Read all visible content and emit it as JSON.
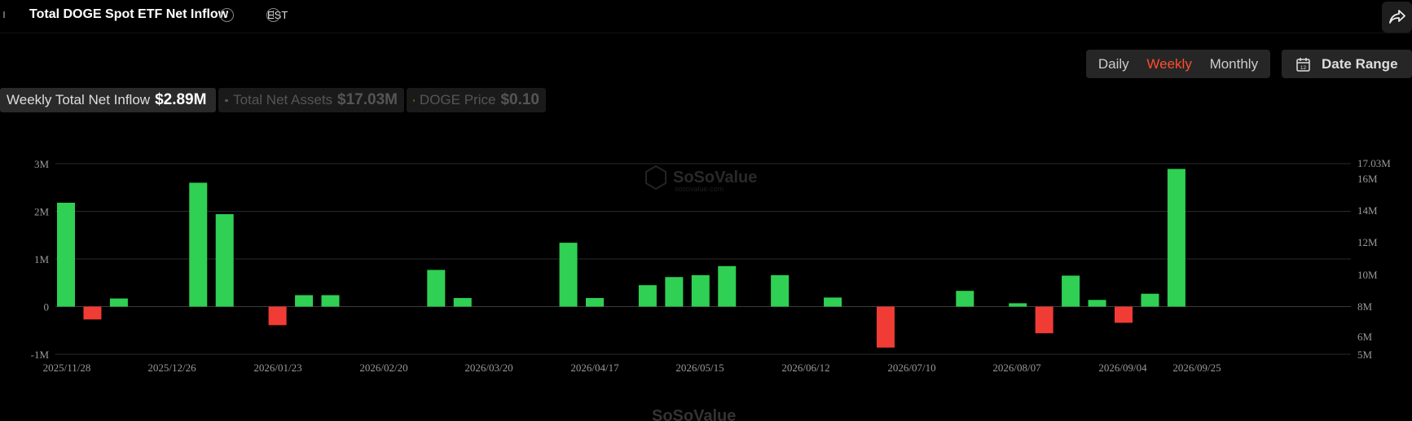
{
  "header": {
    "title": "Total DOGE Spot ETF Net Inflow",
    "timezone": "EST"
  },
  "controls": {
    "periods": [
      "Daily",
      "Weekly",
      "Monthly"
    ],
    "active_period": "Weekly",
    "date_range_label": "Date Range"
  },
  "metrics": [
    {
      "label": "Weekly Total Net Inflow",
      "value": "$2.89M",
      "state": "active"
    },
    {
      "label": "Total Net Assets",
      "value": "$17.03M",
      "state": "inactive",
      "color": "#555555"
    },
    {
      "label": "DOGE Price",
      "value": "$0.10",
      "state": "inactive",
      "color": "#6b5200"
    }
  ],
  "watermark": {
    "brand": "SoSoValue",
    "sub": "sosovalue.com"
  },
  "colors": {
    "positive": "#2fd053",
    "negative": "#f03c35",
    "grid": "#2a2a2a",
    "axis_text": "#999999"
  },
  "chart_data": {
    "type": "bar",
    "title": "Total DOGE Spot ETF Net Inflow",
    "left_axis": {
      "ticks": [
        "-1M",
        "0",
        "1M",
        "2M",
        "3M"
      ],
      "range": [
        -1000000,
        3000000
      ]
    },
    "right_axis": {
      "ticks": [
        "5M",
        "6M",
        "8M",
        "10M",
        "12M",
        "14M",
        "16M",
        "17.03M"
      ]
    },
    "x_tick_labels": [
      "2025/11/28",
      "2025/12/26",
      "2026/01/23",
      "2026/02/20",
      "2026/03/20",
      "2026/04/17",
      "2026/05/15",
      "2026/06/12",
      "2026/07/10",
      "2026/08/07",
      "2026/09/04",
      "2026/09/25"
    ],
    "series": [
      {
        "values": [
          2180000,
          -270000,
          170000,
          0,
          0,
          2600000,
          1940000,
          0,
          -390000,
          240000,
          240000,
          0,
          0,
          0,
          770000,
          180000,
          0,
          0,
          0,
          1340000,
          180000,
          0,
          450000,
          620000,
          660000,
          850000,
          0,
          660000,
          0,
          190000,
          0,
          -860000,
          0,
          0,
          330000,
          0,
          70000,
          -560000,
          650000,
          140000,
          -340000,
          270000,
          2890000
        ]
      }
    ],
    "grid": true
  }
}
